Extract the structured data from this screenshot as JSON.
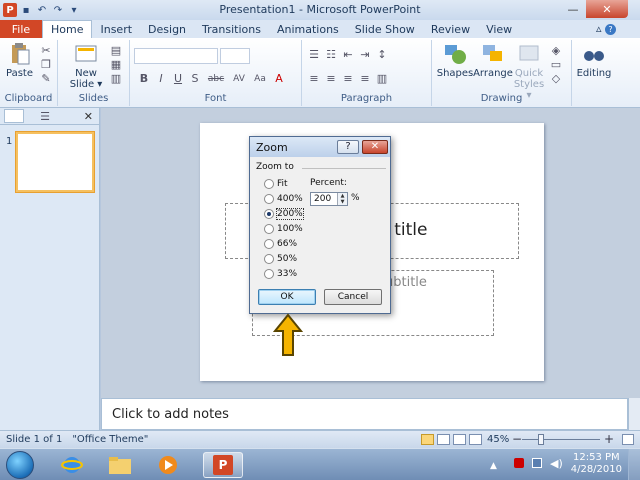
{
  "window": {
    "title": "Presentation1 - Microsoft PowerPoint",
    "minimize": "—",
    "maximize": "☐",
    "close": "✕"
  },
  "tabs": [
    {
      "label": "File"
    },
    {
      "label": "Home"
    },
    {
      "label": "Insert"
    },
    {
      "label": "Design"
    },
    {
      "label": "Transitions"
    },
    {
      "label": "Animations"
    },
    {
      "label": "Slide Show"
    },
    {
      "label": "Review"
    },
    {
      "label": "View"
    }
  ],
  "help_label": "? ",
  "ribbon": {
    "clipboard": {
      "label": "Clipboard",
      "paste": "Paste"
    },
    "slides": {
      "label": "Slides",
      "new_slide": "New Slide ▾"
    },
    "font": {
      "label": "Font",
      "buttons": [
        "B",
        "I",
        "U",
        "S",
        "abc",
        "AV",
        "Aa",
        "A"
      ]
    },
    "paragraph": {
      "label": "Paragraph"
    },
    "drawing": {
      "label": "Drawing",
      "shapes": "Shapes",
      "arrange": "Arrange",
      "quick_styles": "Quick Styles ▾"
    },
    "editing": {
      "label": "",
      "editing": "Editing"
    }
  },
  "slides_panel": {
    "thumb_number": "1",
    "close": "✕"
  },
  "slide": {
    "title_visible": "d title",
    "subtitle_visible": "ubtitle"
  },
  "notes": {
    "placeholder": "Click to add notes"
  },
  "status": {
    "slide_info": "Slide 1 of 1",
    "theme": "\"Office Theme\"",
    "zoom": "45%",
    "zoom_level_fraction": 0.45,
    "minus": "−",
    "plus": "+"
  },
  "dialog": {
    "title": "Zoom",
    "help": "?",
    "close": "✕",
    "zoom_to": "Zoom to",
    "options": [
      {
        "label": "Fit",
        "selected": false
      },
      {
        "label": "400%",
        "selected": false
      },
      {
        "label": "200%",
        "selected": true
      },
      {
        "label": "100%",
        "selected": false
      },
      {
        "label": "66%",
        "selected": false
      },
      {
        "label": "50%",
        "selected": false
      },
      {
        "label": "33%",
        "selected": false
      }
    ],
    "percent_label": "Percent:",
    "percent_value": "200",
    "percent_sign": "%",
    "ok": "OK",
    "cancel": "Cancel"
  },
  "taskbar": {
    "time": "12:53 PM",
    "date": "4/28/2010"
  },
  "colors": {
    "file_tab": "#d24726",
    "arrow": "#f5b400",
    "taskbar": "#6f8db5"
  }
}
